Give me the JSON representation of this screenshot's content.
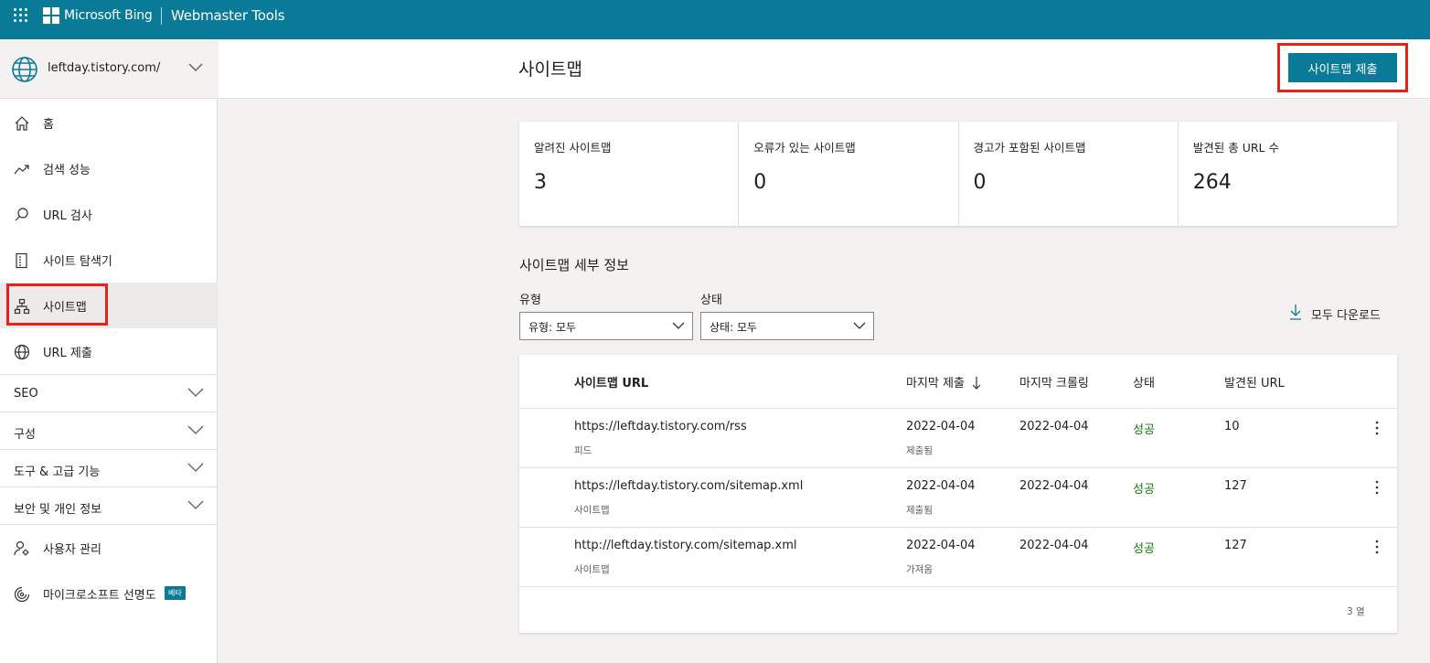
{
  "topbar": {
    "brand": "Microsoft Bing",
    "product": "Webmaster Tools"
  },
  "sidebar": {
    "site": "leftday.tistory.com/",
    "items": [
      {
        "label": "홈",
        "icon": "home-icon"
      },
      {
        "label": "검색 성능",
        "icon": "trending-icon"
      },
      {
        "label": "URL 검사",
        "icon": "search-icon"
      },
      {
        "label": "사이트 탐색기",
        "icon": "document-icon"
      },
      {
        "label": "사이트맵",
        "icon": "sitemap-icon",
        "active": true
      },
      {
        "label": "URL 제출",
        "icon": "globe-icon"
      }
    ],
    "sections": [
      "SEO",
      "구성",
      "도구 & 고급 기능",
      "보안 및 개인 정보"
    ],
    "bottom": [
      {
        "label": "사용자 관리",
        "icon": "user-settings-icon"
      },
      {
        "label": "마이크로소프트 선명도",
        "icon": "clarity-icon",
        "badge": "베타"
      }
    ]
  },
  "header": {
    "title": "사이트맵",
    "submit_label": "사이트맵 제출"
  },
  "stats": [
    {
      "label": "알려진 사이트맵",
      "value": "3"
    },
    {
      "label": "오류가 있는 사이트맵",
      "value": "0"
    },
    {
      "label": "경고가 포함된 사이트맵",
      "value": "0"
    },
    {
      "label": "발견된 총 URL 수",
      "value": "264"
    }
  ],
  "details": {
    "title": "사이트맵 세부 정보",
    "type_label": "유형",
    "type_value": "유형: 모두",
    "status_label": "상태",
    "status_value": "상태: 모두",
    "download_label": "모두 다운로드"
  },
  "table": {
    "columns": [
      "사이트맵 URL",
      "마지막 제출",
      "마지막 크롤링",
      "상태",
      "발견된 URL"
    ],
    "rows": [
      {
        "url": "https://leftday.tistory.com/rss",
        "kind": "피드",
        "submitted": "2022-04-04",
        "submitted_note": "제출됨",
        "crawled": "2022-04-04",
        "status": "성공",
        "found": "10"
      },
      {
        "url": "https://leftday.tistory.com/sitemap.xml",
        "kind": "사이트맵",
        "submitted": "2022-04-04",
        "submitted_note": "제출됨",
        "crawled": "2022-04-04",
        "status": "성공",
        "found": "127"
      },
      {
        "url": "http://leftday.tistory.com/sitemap.xml",
        "kind": "사이트맵",
        "submitted": "2022-04-04",
        "submitted_note": "가져옴",
        "crawled": "2022-04-04",
        "status": "성공",
        "found": "127"
      }
    ],
    "count_text": "3 열"
  },
  "colors": {
    "brand": "#0a7a99",
    "success": "#107c10",
    "highlight": "#e8221b"
  }
}
